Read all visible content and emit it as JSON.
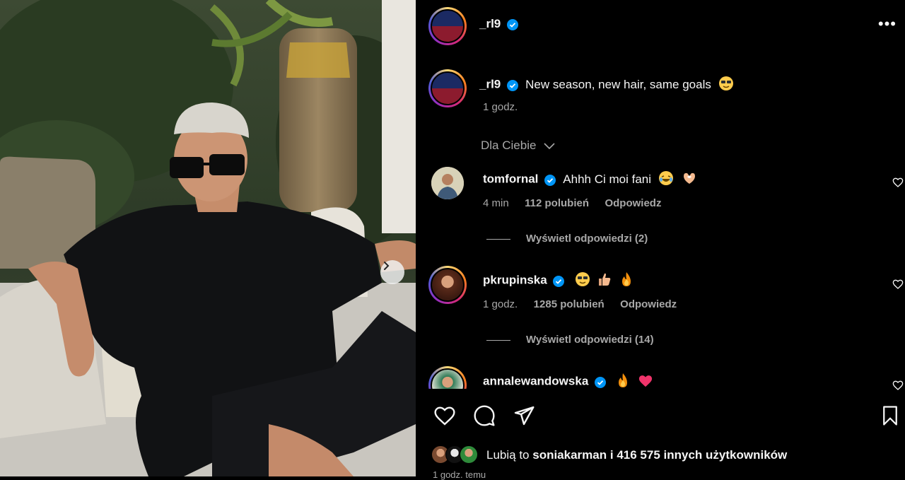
{
  "post": {
    "author": "_rl9",
    "caption": "New season, new hair, same goals",
    "caption_time": "1 godz."
  },
  "filter": {
    "label": "Dla Ciebie"
  },
  "comments": [
    {
      "user": "tomfornal",
      "text": "Ahhh Ci moi fani",
      "time": "4 min",
      "likes": "112 polubień",
      "reply": "Odpowiedz",
      "view_replies": "Wyświetl odpowiedzi (2)"
    },
    {
      "user": "pkrupinska",
      "text": "",
      "time": "1 godz.",
      "likes": "1285 polubień",
      "reply": "Odpowiedz",
      "view_replies": "Wyświetl odpowiedzi (14)"
    },
    {
      "user": "annalewandowska",
      "text": ""
    }
  ],
  "likes_summary": {
    "prefix": "Lubią to",
    "user": "soniakarman",
    "middle": "i",
    "count": "416 575",
    "suffix": "innych użytkowników"
  },
  "footer_time": "1 godz. temu",
  "colors": {
    "verified": "#0095f6",
    "background": "#000000",
    "muted": "#a8a8a8"
  },
  "icons": [
    "more-icon",
    "chevron-right-icon",
    "heart-icon",
    "comment-icon",
    "share-icon",
    "bookmark-icon",
    "verified-icon"
  ]
}
